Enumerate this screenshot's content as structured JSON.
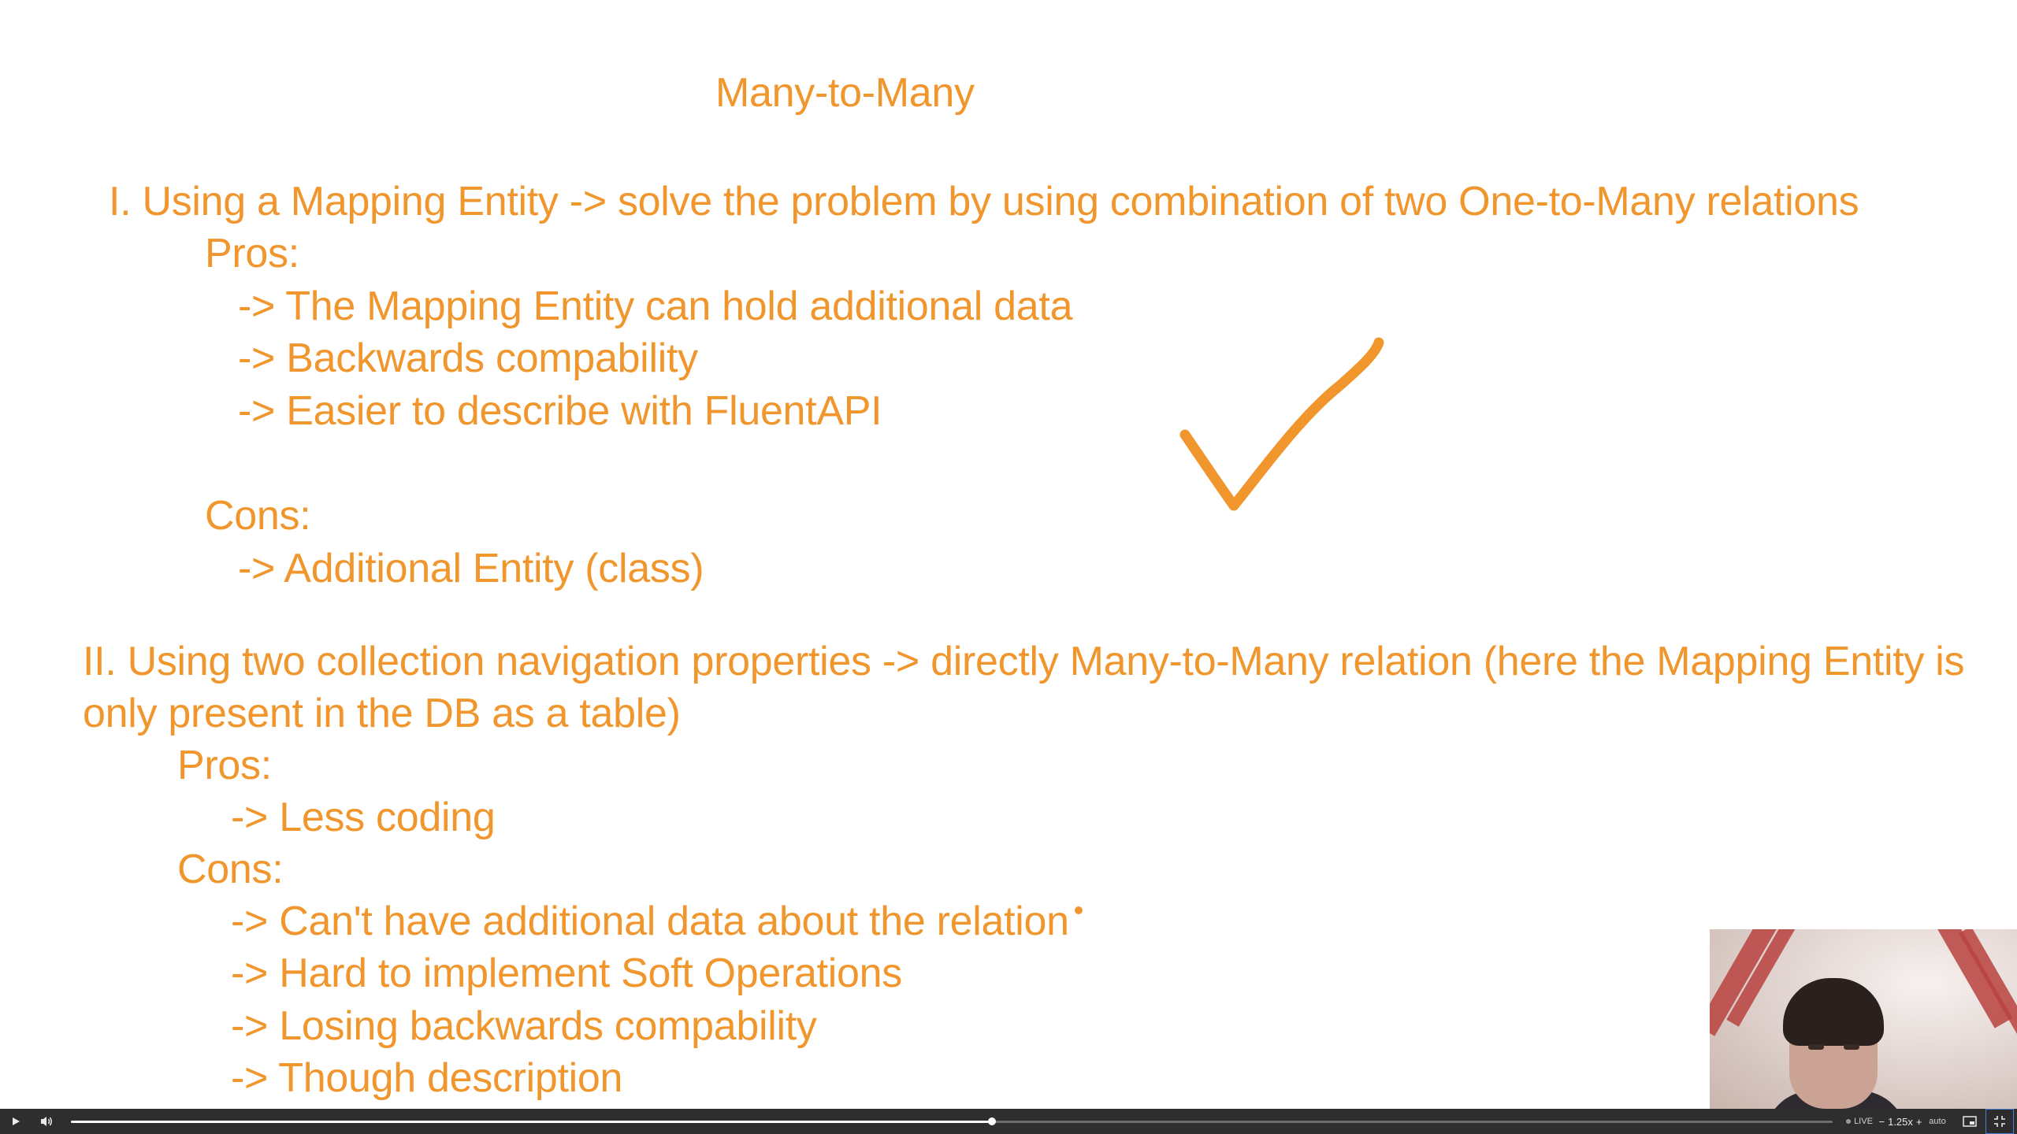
{
  "slide": {
    "title": "Many-to-Many",
    "section1": {
      "heading": "I. Using a Mapping Entity -> solve the problem by using combination of two One-to-Many relations",
      "pros_label": "Pros:",
      "pros": [
        "-> The Mapping Entity can hold additional data",
        "-> Backwards compability",
        "-> Easier to describe with FluentAPI"
      ],
      "cons_label": "Cons:",
      "cons": [
        "-> Additional Entity (class)"
      ]
    },
    "section2": {
      "heading_line1": "II. Using two collection navigation properties -> directly Many-to-Many relation (here the Mapping Entity is",
      "heading_line2": "only present in the DB as a table)",
      "pros_label": "Pros:",
      "pros": [
        "-> Less coding"
      ],
      "cons_label": "Cons:",
      "cons": [
        "-> Can't have additional data about the relation",
        "-> Hard to implement Soft Operations",
        "-> Losing backwards compability",
        "-> Though description"
      ]
    },
    "annotation_icon": "checkmark-icon",
    "text_color": "#f0962c"
  },
  "player": {
    "play_icon": "play-icon",
    "volume_icon": "volume-icon",
    "progress_fraction": 0.523,
    "live_label": "LIVE",
    "speed_minus": "−",
    "speed_value": "1.25x",
    "speed_plus": "+",
    "quality_label": "auto",
    "pip_icon": "picture-in-picture-icon",
    "fullscreen_icon": "exit-fullscreen-icon"
  }
}
